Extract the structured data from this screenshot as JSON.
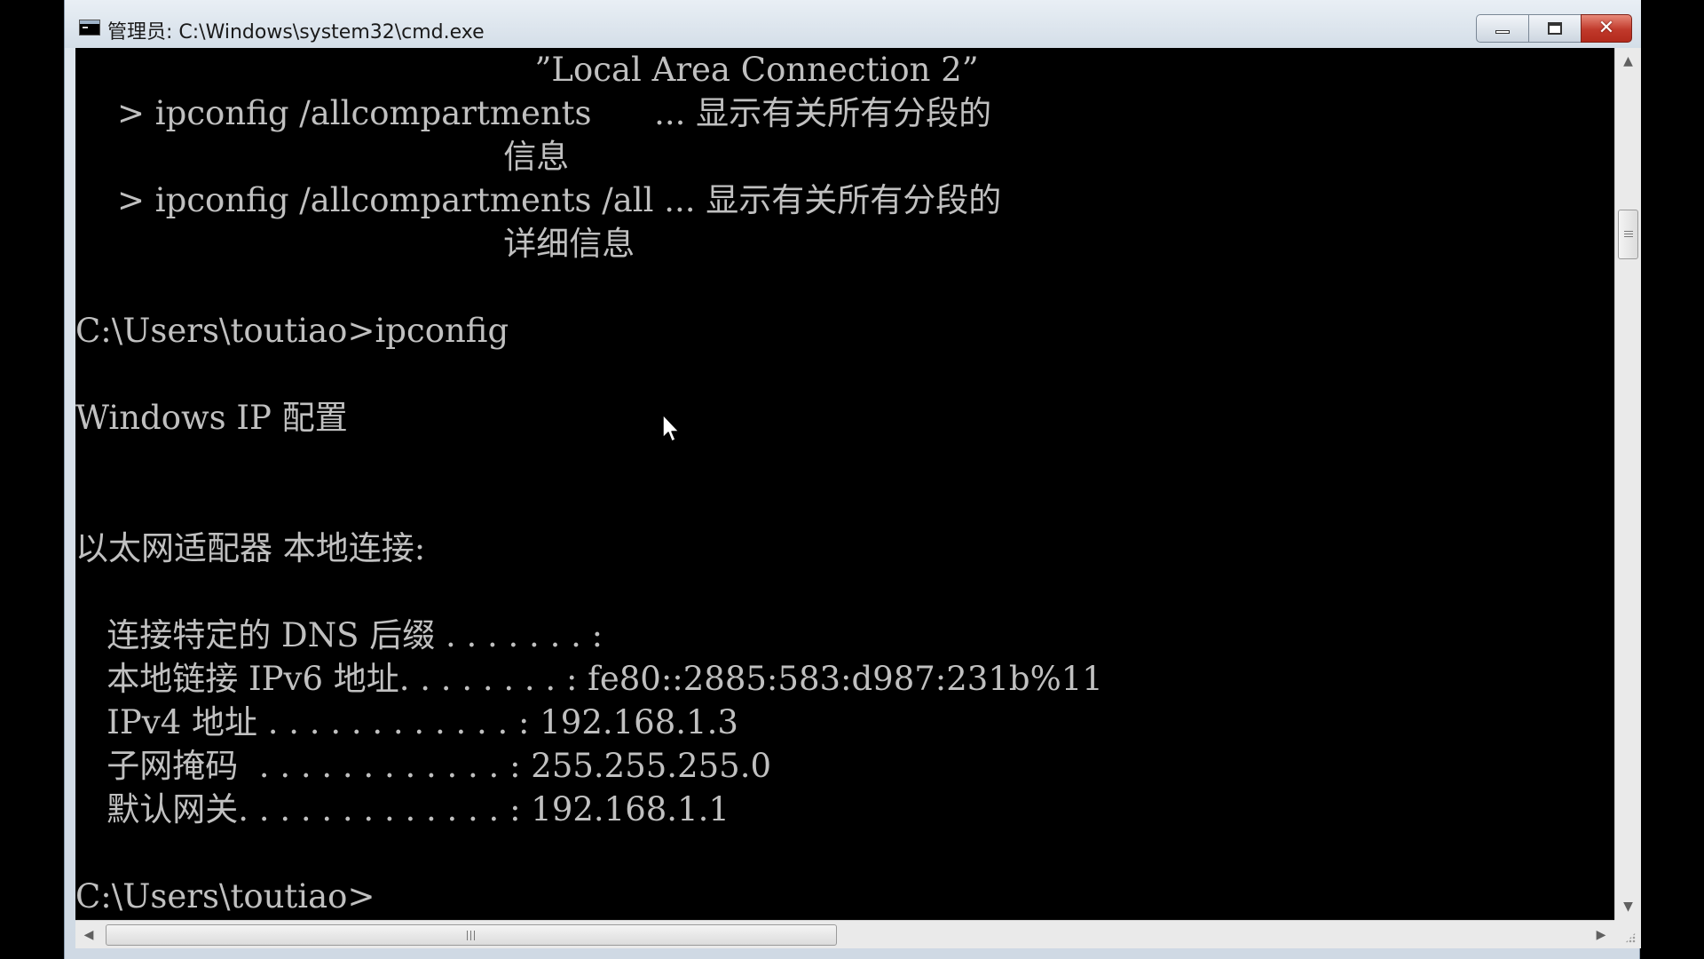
{
  "window": {
    "title": "管理员: C:\\Windows\\system32\\cmd.exe",
    "controls": {
      "minimize": "minimize",
      "maximize": "maximize",
      "close": "✕"
    }
  },
  "console": {
    "lines": [
      "                                            ”Local Area Connection 2”",
      "    > ipconfig /allcompartments      ... 显示有关所有分段的",
      "                                         信息",
      "    > ipconfig /allcompartments /all ... 显示有关所有分段的",
      "                                         详细信息",
      "",
      "C:\\Users\\toutiao>ipconfig",
      "",
      "Windows IP 配置",
      "",
      "",
      "以太网适配器 本地连接:",
      "",
      "   连接特定的 DNS 后缀 . . . . . . . :",
      "   本地链接 IPv6 地址. . . . . . . . : fe80::2885:583:d987:231b%11",
      "   IPv4 地址 . . . . . . . . . . . . : 192.168.1.3",
      "   子网掩码  . . . . . . . . . . . . : 255.255.255.0",
      "   默认网关. . . . . . . . . . . . . : 192.168.1.1",
      "",
      "C:\\Users\\toutiao>"
    ]
  },
  "colors": {
    "console_bg": "#000000",
    "console_fg": "#c0c0c0",
    "close_button": "#c0392b"
  },
  "icons": {
    "window": "cmd-window-icon",
    "cursor": "mouse-pointer-icon"
  }
}
